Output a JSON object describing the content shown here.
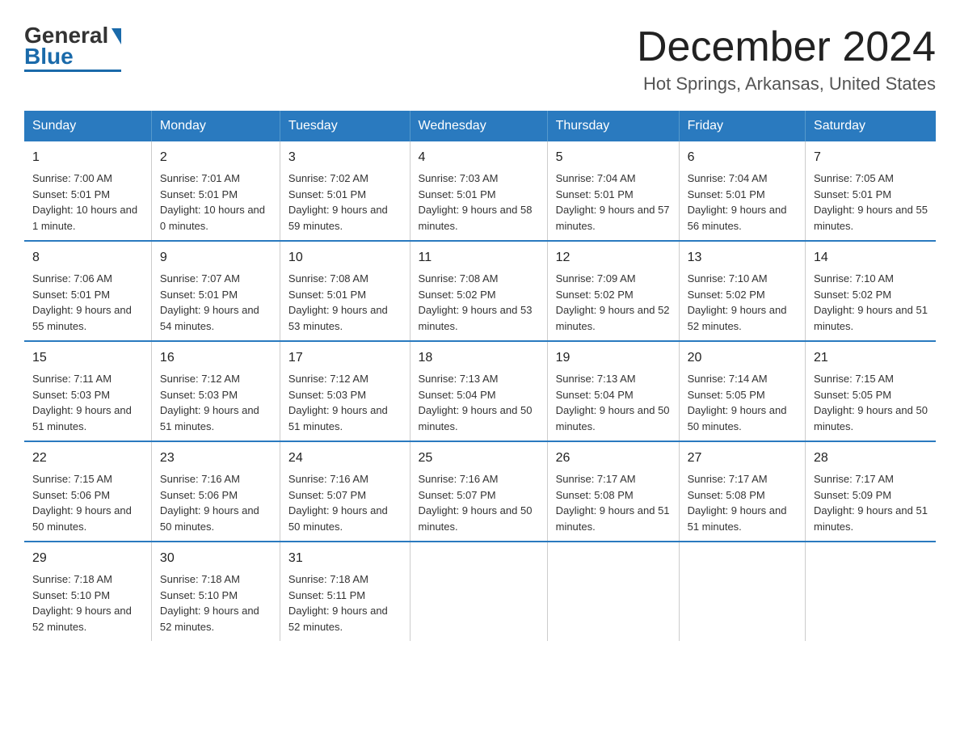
{
  "logo": {
    "general": "General",
    "blue": "Blue"
  },
  "title": "December 2024",
  "subtitle": "Hot Springs, Arkansas, United States",
  "days_header": [
    "Sunday",
    "Monday",
    "Tuesday",
    "Wednesday",
    "Thursday",
    "Friday",
    "Saturday"
  ],
  "weeks": [
    [
      {
        "day": "1",
        "sunrise": "7:00 AM",
        "sunset": "5:01 PM",
        "daylight": "10 hours and 1 minute."
      },
      {
        "day": "2",
        "sunrise": "7:01 AM",
        "sunset": "5:01 PM",
        "daylight": "10 hours and 0 minutes."
      },
      {
        "day": "3",
        "sunrise": "7:02 AM",
        "sunset": "5:01 PM",
        "daylight": "9 hours and 59 minutes."
      },
      {
        "day": "4",
        "sunrise": "7:03 AM",
        "sunset": "5:01 PM",
        "daylight": "9 hours and 58 minutes."
      },
      {
        "day": "5",
        "sunrise": "7:04 AM",
        "sunset": "5:01 PM",
        "daylight": "9 hours and 57 minutes."
      },
      {
        "day": "6",
        "sunrise": "7:04 AM",
        "sunset": "5:01 PM",
        "daylight": "9 hours and 56 minutes."
      },
      {
        "day": "7",
        "sunrise": "7:05 AM",
        "sunset": "5:01 PM",
        "daylight": "9 hours and 55 minutes."
      }
    ],
    [
      {
        "day": "8",
        "sunrise": "7:06 AM",
        "sunset": "5:01 PM",
        "daylight": "9 hours and 55 minutes."
      },
      {
        "day": "9",
        "sunrise": "7:07 AM",
        "sunset": "5:01 PM",
        "daylight": "9 hours and 54 minutes."
      },
      {
        "day": "10",
        "sunrise": "7:08 AM",
        "sunset": "5:01 PM",
        "daylight": "9 hours and 53 minutes."
      },
      {
        "day": "11",
        "sunrise": "7:08 AM",
        "sunset": "5:02 PM",
        "daylight": "9 hours and 53 minutes."
      },
      {
        "day": "12",
        "sunrise": "7:09 AM",
        "sunset": "5:02 PM",
        "daylight": "9 hours and 52 minutes."
      },
      {
        "day": "13",
        "sunrise": "7:10 AM",
        "sunset": "5:02 PM",
        "daylight": "9 hours and 52 minutes."
      },
      {
        "day": "14",
        "sunrise": "7:10 AM",
        "sunset": "5:02 PM",
        "daylight": "9 hours and 51 minutes."
      }
    ],
    [
      {
        "day": "15",
        "sunrise": "7:11 AM",
        "sunset": "5:03 PM",
        "daylight": "9 hours and 51 minutes."
      },
      {
        "day": "16",
        "sunrise": "7:12 AM",
        "sunset": "5:03 PM",
        "daylight": "9 hours and 51 minutes."
      },
      {
        "day": "17",
        "sunrise": "7:12 AM",
        "sunset": "5:03 PM",
        "daylight": "9 hours and 51 minutes."
      },
      {
        "day": "18",
        "sunrise": "7:13 AM",
        "sunset": "5:04 PM",
        "daylight": "9 hours and 50 minutes."
      },
      {
        "day": "19",
        "sunrise": "7:13 AM",
        "sunset": "5:04 PM",
        "daylight": "9 hours and 50 minutes."
      },
      {
        "day": "20",
        "sunrise": "7:14 AM",
        "sunset": "5:05 PM",
        "daylight": "9 hours and 50 minutes."
      },
      {
        "day": "21",
        "sunrise": "7:15 AM",
        "sunset": "5:05 PM",
        "daylight": "9 hours and 50 minutes."
      }
    ],
    [
      {
        "day": "22",
        "sunrise": "7:15 AM",
        "sunset": "5:06 PM",
        "daylight": "9 hours and 50 minutes."
      },
      {
        "day": "23",
        "sunrise": "7:16 AM",
        "sunset": "5:06 PM",
        "daylight": "9 hours and 50 minutes."
      },
      {
        "day": "24",
        "sunrise": "7:16 AM",
        "sunset": "5:07 PM",
        "daylight": "9 hours and 50 minutes."
      },
      {
        "day": "25",
        "sunrise": "7:16 AM",
        "sunset": "5:07 PM",
        "daylight": "9 hours and 50 minutes."
      },
      {
        "day": "26",
        "sunrise": "7:17 AM",
        "sunset": "5:08 PM",
        "daylight": "9 hours and 51 minutes."
      },
      {
        "day": "27",
        "sunrise": "7:17 AM",
        "sunset": "5:08 PM",
        "daylight": "9 hours and 51 minutes."
      },
      {
        "day": "28",
        "sunrise": "7:17 AM",
        "sunset": "5:09 PM",
        "daylight": "9 hours and 51 minutes."
      }
    ],
    [
      {
        "day": "29",
        "sunrise": "7:18 AM",
        "sunset": "5:10 PM",
        "daylight": "9 hours and 52 minutes."
      },
      {
        "day": "30",
        "sunrise": "7:18 AM",
        "sunset": "5:10 PM",
        "daylight": "9 hours and 52 minutes."
      },
      {
        "day": "31",
        "sunrise": "7:18 AM",
        "sunset": "5:11 PM",
        "daylight": "9 hours and 52 minutes."
      },
      {
        "day": "",
        "sunrise": "",
        "sunset": "",
        "daylight": ""
      },
      {
        "day": "",
        "sunrise": "",
        "sunset": "",
        "daylight": ""
      },
      {
        "day": "",
        "sunrise": "",
        "sunset": "",
        "daylight": ""
      },
      {
        "day": "",
        "sunrise": "",
        "sunset": "",
        "daylight": ""
      }
    ]
  ]
}
